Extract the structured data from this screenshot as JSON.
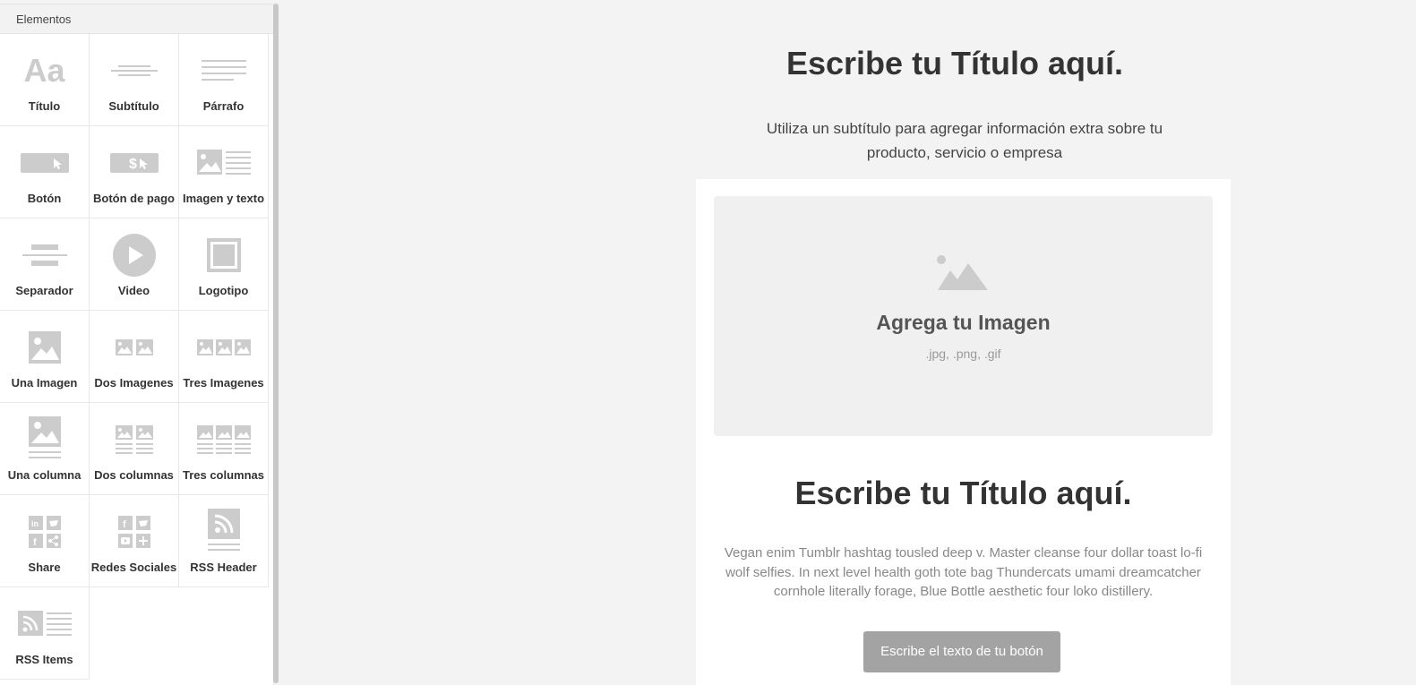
{
  "sidebar": {
    "header": "Elementos",
    "items": [
      {
        "label": "Título",
        "icon": "title-icon"
      },
      {
        "label": "Subtítulo",
        "icon": "subtitle-icon"
      },
      {
        "label": "Párrafo",
        "icon": "paragraph-icon"
      },
      {
        "label": "Botón",
        "icon": "button-icon"
      },
      {
        "label": "Botón de pago",
        "icon": "payment-button-icon"
      },
      {
        "label": "Imagen y texto",
        "icon": "image-text-icon"
      },
      {
        "label": "Separador",
        "icon": "separator-icon"
      },
      {
        "label": "Video",
        "icon": "video-icon"
      },
      {
        "label": "Logotipo",
        "icon": "logo-icon"
      },
      {
        "label": "Una Imagen",
        "icon": "one-image-icon"
      },
      {
        "label": "Dos Imagenes",
        "icon": "two-images-icon"
      },
      {
        "label": "Tres Imagenes",
        "icon": "three-images-icon"
      },
      {
        "label": "Una columna",
        "icon": "one-column-icon"
      },
      {
        "label": "Dos columnas",
        "icon": "two-columns-icon"
      },
      {
        "label": "Tres columnas",
        "icon": "three-columns-icon"
      },
      {
        "label": "Share",
        "icon": "share-icon"
      },
      {
        "label": "Redes Sociales",
        "icon": "social-networks-icon"
      },
      {
        "label": "RSS Header",
        "icon": "rss-header-icon"
      },
      {
        "label": "RSS Items",
        "icon": "rss-items-icon"
      }
    ]
  },
  "canvas": {
    "title": "Escribe tu Título aquí.",
    "subtitle": "Utiliza un subtítulo para agregar información extra sobre tu producto, servicio o empresa",
    "image_block": {
      "title": "Agrega tu Imagen",
      "formats": ".jpg, .png, .gif"
    },
    "title2": "Escribe tu Título aquí.",
    "paragraph": "Vegan enim Tumblr hashtag tousled deep v. Master cleanse four dollar toast lo-fi wolf selfies. In next level health goth tote bag Thundercats umami dreamcatcher cornhole literally forage, Blue Bottle aesthetic four loko distillery.",
    "button_label": "Escribe el texto de tu botón"
  },
  "colors": {
    "icon_gray": "#cccccc",
    "button_gray": "#a3a3a3",
    "canvas_bg": "#f3f3f3"
  }
}
